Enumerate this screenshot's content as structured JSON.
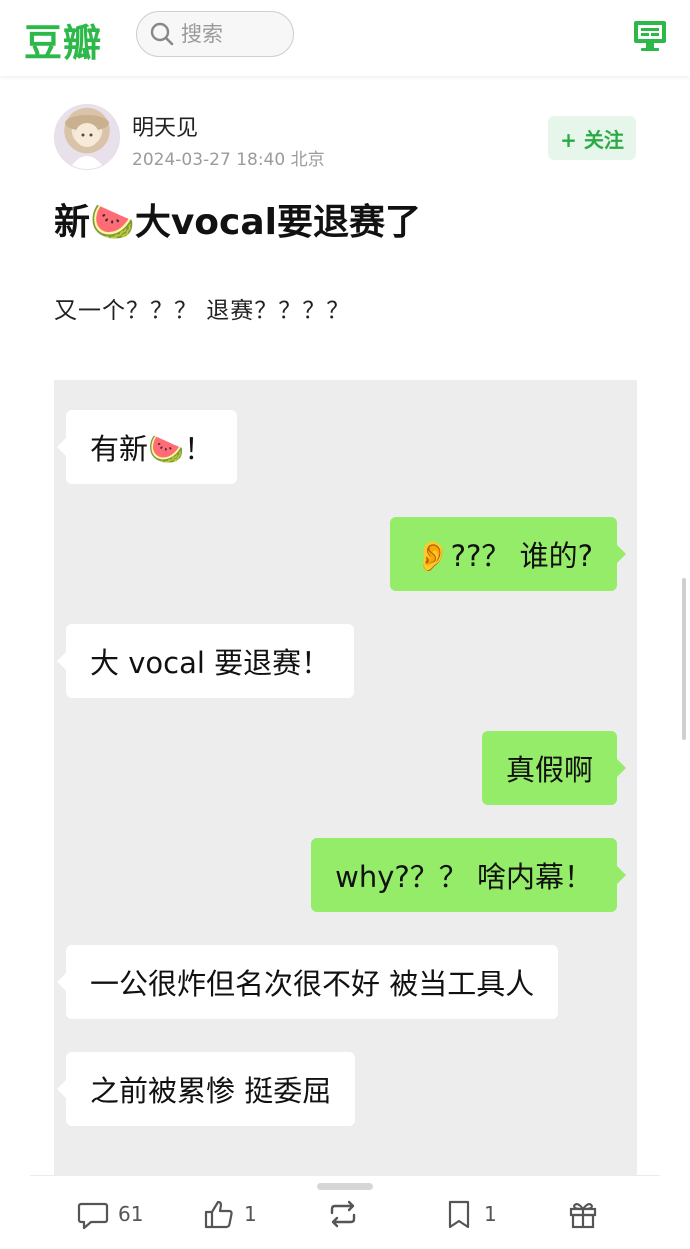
{
  "header": {
    "logo_text": "豆瓣",
    "search_placeholder": "搜索"
  },
  "post": {
    "username": "明天见",
    "timestamp": "2024-03-27 18:40",
    "location": "北京",
    "follow_label": "+ 关注",
    "title": "新🍉大vocal要退赛了",
    "body": "又一个？？？ 退赛？？？？"
  },
  "chat": {
    "messages": [
      {
        "side": "left",
        "text": "有新🍉！"
      },
      {
        "side": "right",
        "text": "👂??？ 谁的?"
      },
      {
        "side": "left",
        "text": "大 vocal 要退赛！"
      },
      {
        "side": "right",
        "text": "真假啊"
      },
      {
        "side": "right",
        "text": "why?？？ 啥内幕！"
      },
      {
        "side": "left",
        "text": "一公很炸但名次很不好 被当工具人"
      },
      {
        "side": "left",
        "text": "之前被累惨 挺委屈"
      }
    ]
  },
  "actions": {
    "comments_count": "61",
    "likes_count": "1",
    "repost_count": "",
    "collect_count": "1"
  },
  "colors": {
    "brand": "#2db84a",
    "bubble_right": "#95ec69",
    "chat_bg": "#ededed"
  }
}
